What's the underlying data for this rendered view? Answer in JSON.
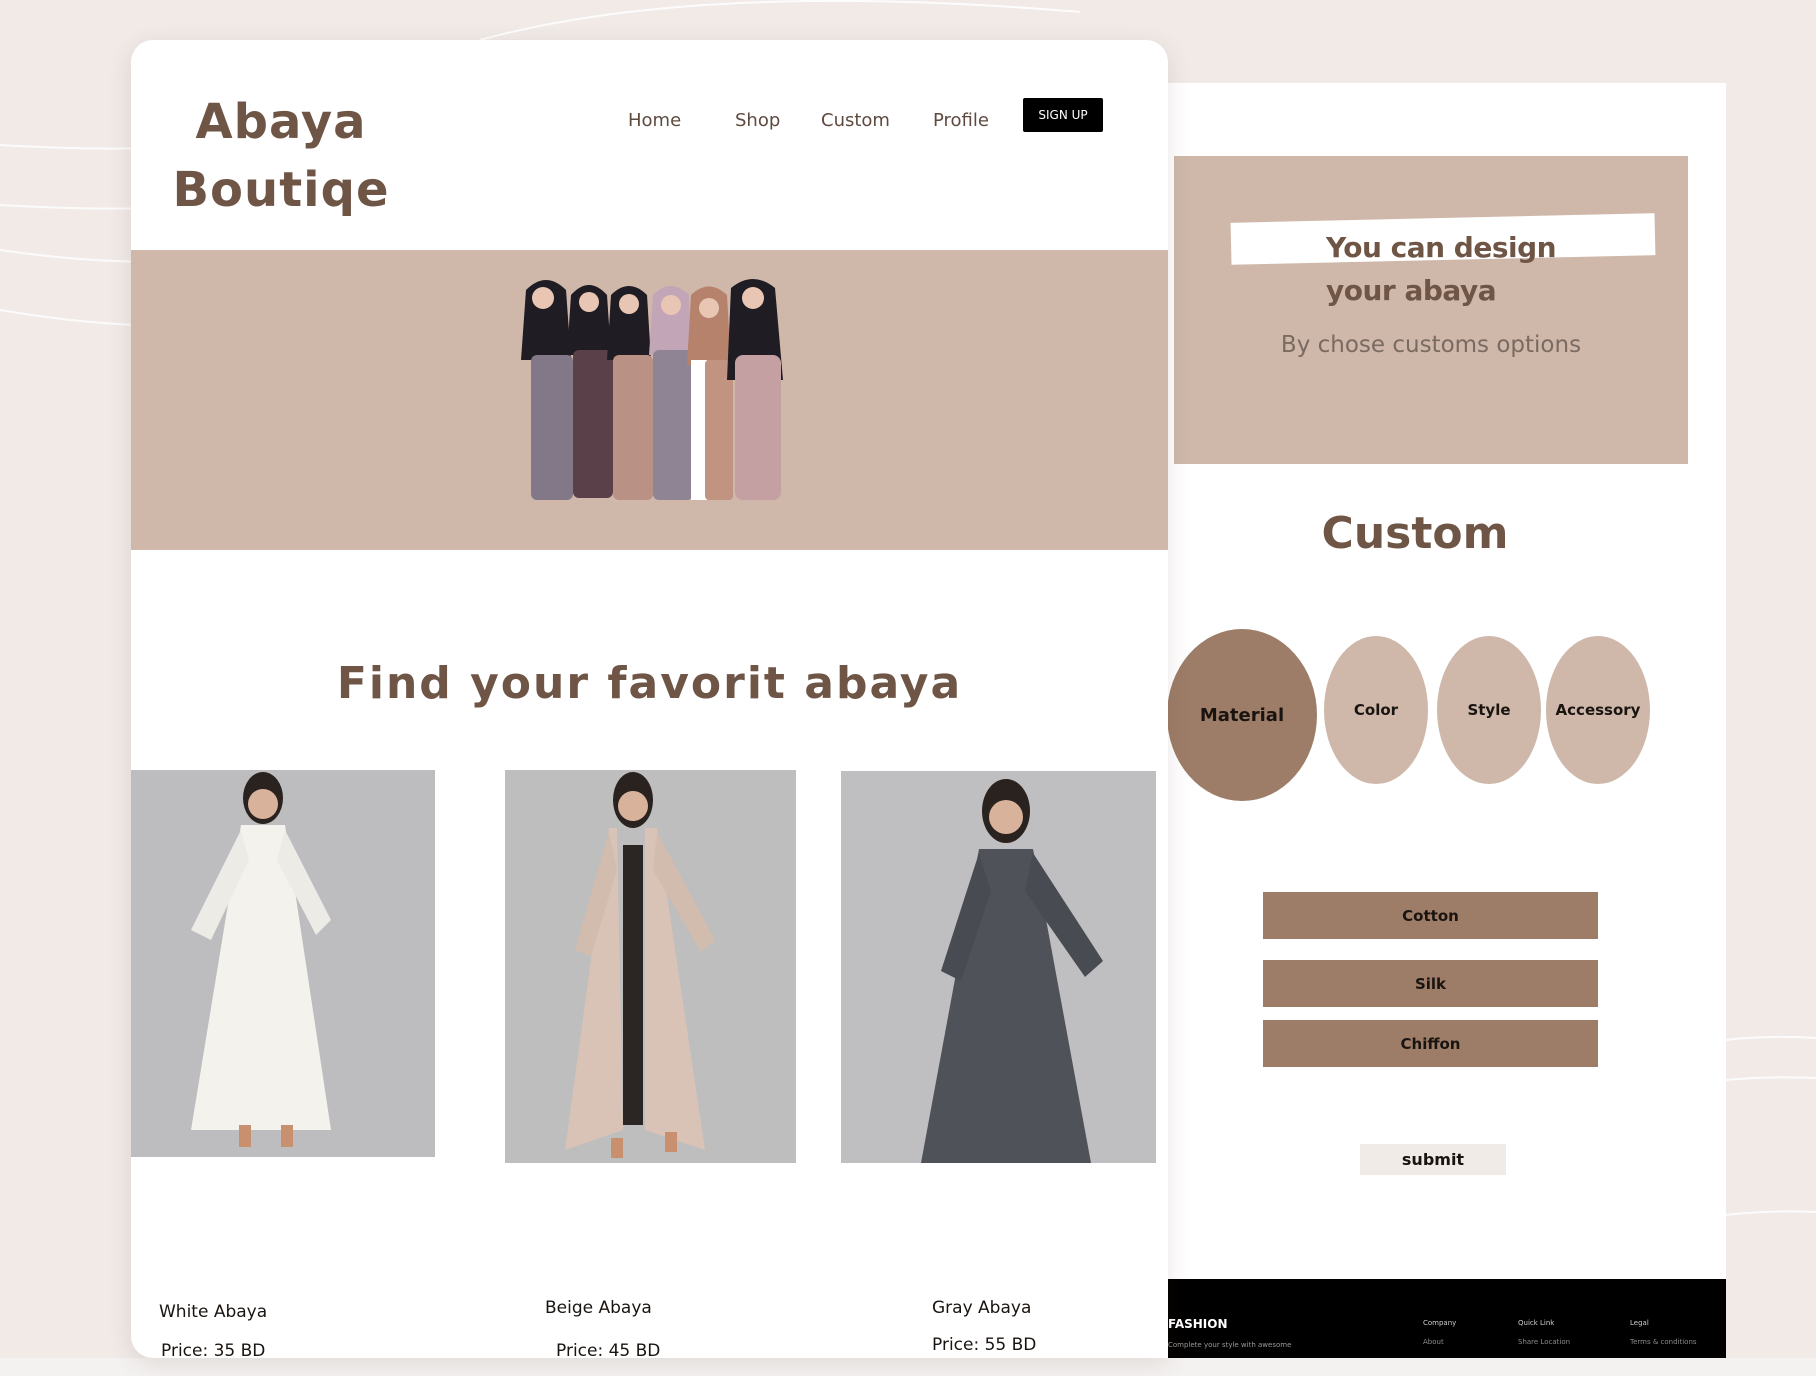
{
  "brand": {
    "line1": "Abaya",
    "line2": "Boutiqe"
  },
  "nav": {
    "home": "Home",
    "shop": "Shop",
    "custom": "Custom",
    "profile": "Profile",
    "signup": "SIGN UP"
  },
  "main": {
    "section_title": "Find your favorit abaya",
    "products": [
      {
        "name": "White Abaya",
        "price": "Price: 35 BD",
        "color": "#f3f1ec"
      },
      {
        "name": "Beige Abaya",
        "price": "Price: 45 BD",
        "color": "#d6c2b6"
      },
      {
        "name": "Gray Abaya",
        "price": "Price: 55 BD",
        "color": "#4f5259"
      }
    ]
  },
  "custom_panel": {
    "promo_line1": "You can design",
    "promo_line2": "your abaya",
    "promo_sub": "By chose customs options",
    "title": "Custom",
    "options": [
      "Material",
      "Color",
      "Style",
      "Accessory"
    ],
    "materials": [
      "Cotton",
      "Silk",
      "Chiffon"
    ],
    "submit": "submit"
  },
  "footer": {
    "brand": "FASHION",
    "tagline": "Complete your style with awesome",
    "columns": [
      {
        "heading": "Company",
        "link": "About"
      },
      {
        "heading": "Quick Link",
        "link": "Share Location"
      },
      {
        "heading": "Legal",
        "link": "Terms & conditions"
      }
    ]
  },
  "colors": {
    "background": "#f1eae7",
    "brand_brown": "#6f5546",
    "accent_tan": "#cfb8aa",
    "accent_brown": "#9d7d68"
  }
}
